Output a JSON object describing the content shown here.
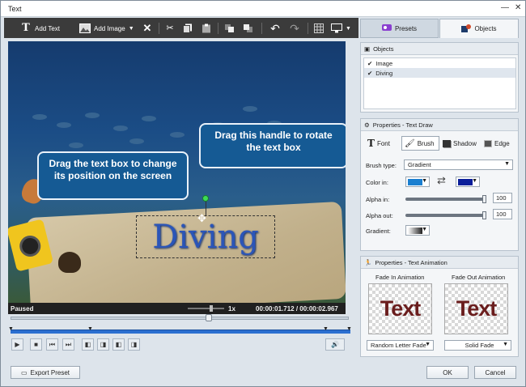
{
  "window": {
    "title": "Text",
    "minimize": "—",
    "close": "✕"
  },
  "toolbar": {
    "add_text": "Add Text",
    "add_image": "Add Image",
    "icons": [
      "text-icon",
      "image-icon",
      "delete-icon",
      "cut-icon",
      "copy-icon",
      "paste-icon",
      "bring-front-icon",
      "send-back-icon",
      "undo-icon",
      "redo-icon",
      "grid-icon",
      "monitor-icon"
    ]
  },
  "canvas": {
    "text_object": "Diving",
    "callout_left": "Drag the text box to change its position on the screen",
    "callout_right": "Drag this handle to rotate the text box",
    "colors": {
      "callout": "#155a94",
      "text": "#2b55b8"
    }
  },
  "status": {
    "state": "Paused",
    "speed": "1x",
    "time": "00:00:01.712 / 00:00:02.967"
  },
  "footer": {
    "export": "Export Preset",
    "ok": "OK",
    "cancel": "Cancel"
  },
  "right": {
    "tabs": [
      {
        "label": "Presets"
      },
      {
        "label": "Objects"
      }
    ],
    "objects": {
      "title": "Objects",
      "items": [
        {
          "label": "Image",
          "checked": true
        },
        {
          "label": "Diving",
          "checked": true,
          "selected": true
        }
      ]
    },
    "properties": {
      "title": "Properties - Text Draw",
      "tabs": [
        "Font",
        "Brush",
        "Shadow",
        "Edge"
      ],
      "brush_type_label": "Brush type:",
      "brush_type": "Gradient",
      "color_in_label": "Color in:",
      "color_in_colors": [
        "#1a7fd0",
        "#0a1e9a"
      ],
      "alpha_in_label": "Alpha in:",
      "alpha_in": "100",
      "alpha_out_label": "Alpha out:",
      "alpha_out": "100",
      "gradient_label": "Gradient:"
    },
    "animation": {
      "title": "Properties - Text Animation",
      "fade_in_label": "Fade In Animation",
      "fade_out_label": "Fade Out Animation",
      "preview_text": "Text",
      "fade_in_value": "Random Letter Fade",
      "fade_out_value": "Solid Fade"
    }
  }
}
